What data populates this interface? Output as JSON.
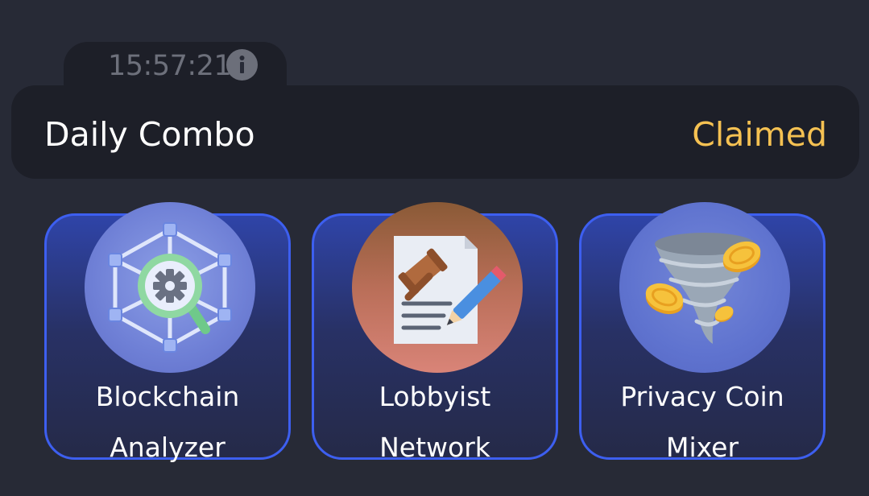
{
  "timer": {
    "time": "15:57:21",
    "info_icon": "info-icon"
  },
  "daily_combo": {
    "title": "Daily Combo",
    "status": "Claimed",
    "status_color": "#f5c152"
  },
  "cards": [
    {
      "line1": "Blockchain",
      "line2": "Analyzer",
      "icon": "blockchain-analyzer-icon"
    },
    {
      "line1": "Lobbyist",
      "line2": "Network",
      "icon": "gavel-document-icon"
    },
    {
      "line1": "Privacy Coin",
      "line2": "Mixer",
      "icon": "coin-tornado-icon"
    }
  ],
  "colors": {
    "background": "#272a36",
    "panel": "#1d1f28",
    "card_border": "#3d5ff0"
  }
}
